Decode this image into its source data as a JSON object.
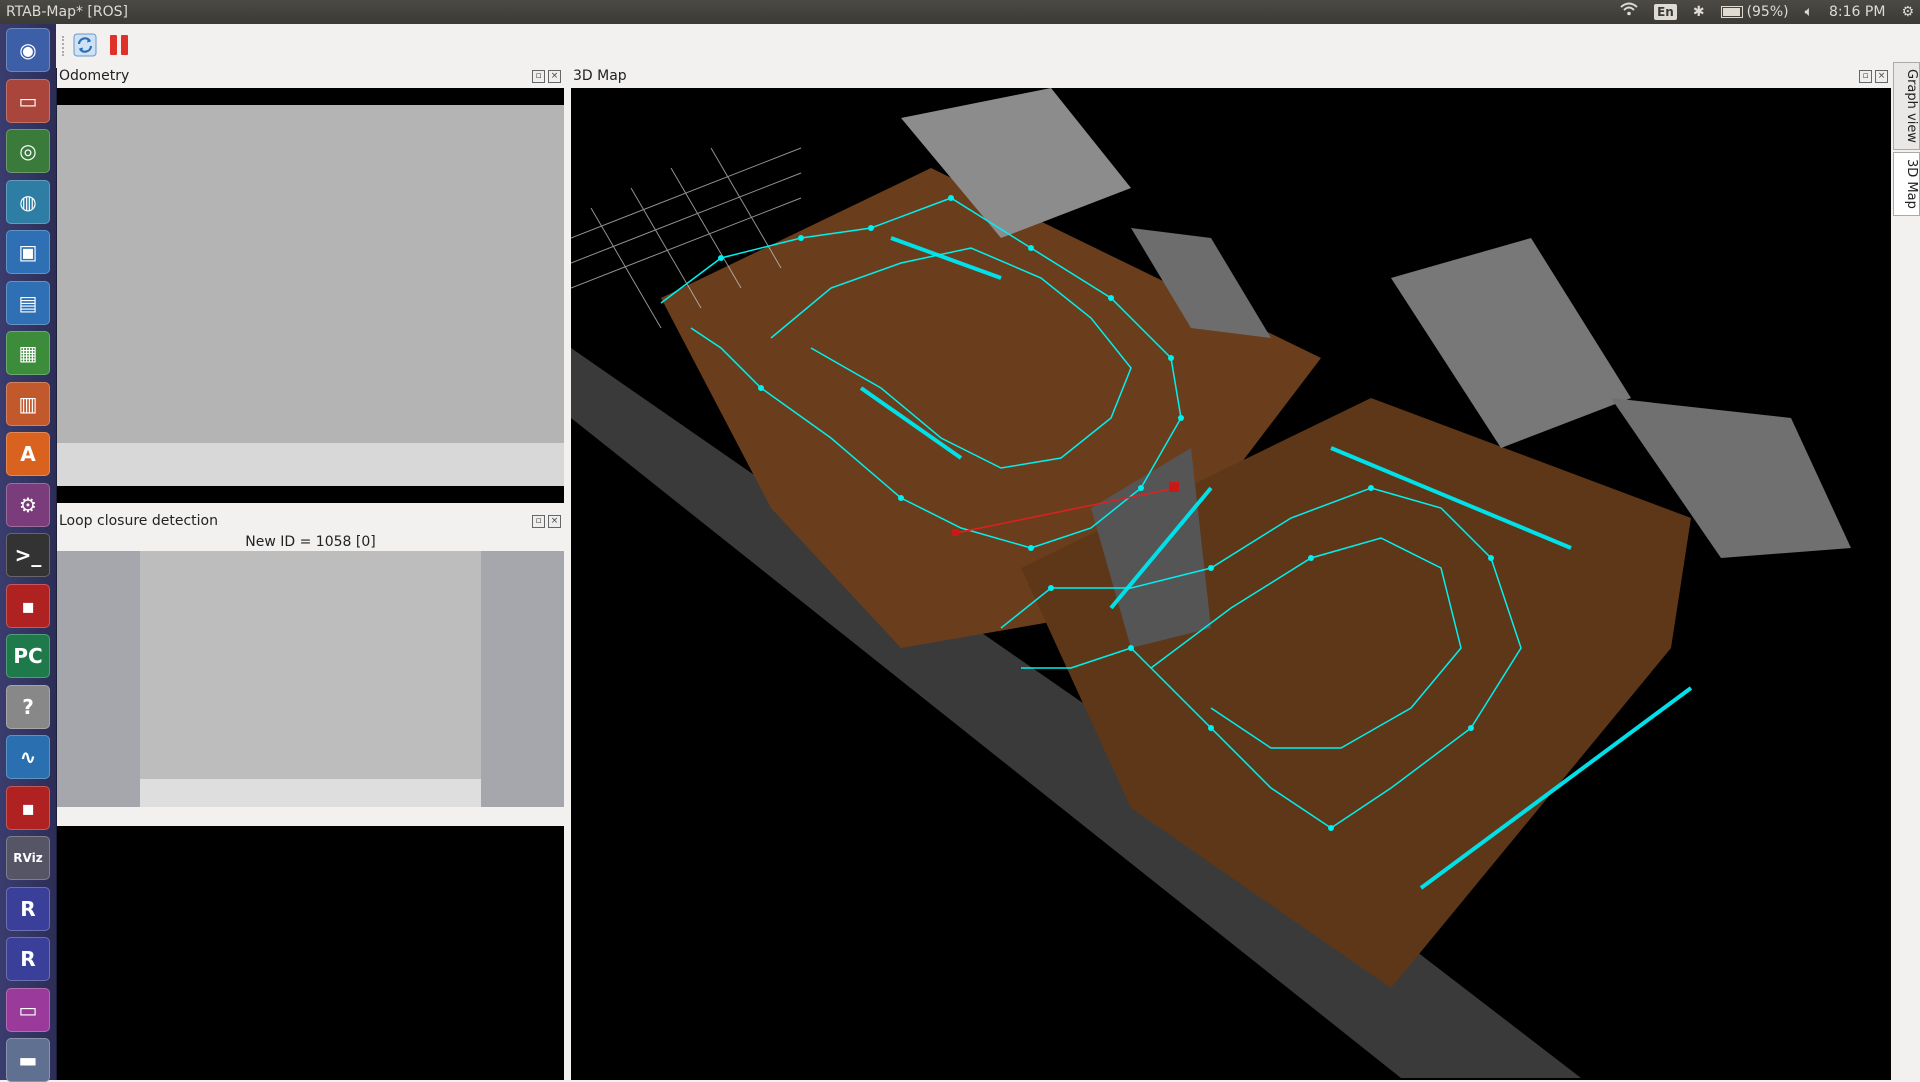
{
  "window": {
    "title": "RTAB-Map* [ROS]"
  },
  "tray": {
    "keyboard": "En",
    "battery": "(95%)",
    "clock": "8:16 PM"
  },
  "launcher": {
    "items": [
      {
        "icon": "ubuntu-dash-icon",
        "glyph": "◉",
        "color": "#3d5fa8"
      },
      {
        "icon": "files-icon",
        "glyph": "▭",
        "color": "#a9453a"
      },
      {
        "icon": "chrome-icon",
        "glyph": "◎",
        "color": "#3a7a3a"
      },
      {
        "icon": "globe-icon",
        "glyph": "◍",
        "color": "#2e7da4"
      },
      {
        "icon": "virtualbox-icon",
        "glyph": "▣",
        "color": "#2f6fb3"
      },
      {
        "icon": "writer-icon",
        "glyph": "▤",
        "color": "#2f6fb3"
      },
      {
        "icon": "calc-icon",
        "glyph": "▦",
        "color": "#3c8c3c"
      },
      {
        "icon": "impress-icon",
        "glyph": "▥",
        "color": "#c2592d"
      },
      {
        "icon": "software-center-icon",
        "glyph": "A",
        "color": "#d9621f"
      },
      {
        "icon": "settings-icon",
        "glyph": "⚙",
        "color": "#7a3c7a"
      },
      {
        "icon": "terminal-icon",
        "glyph": ">_",
        "color": "#333333"
      },
      {
        "icon": "app-red-icon",
        "glyph": "▪",
        "color": "#b02222"
      },
      {
        "icon": "pycharm-icon",
        "glyph": "PC",
        "color": "#1e7a4a"
      },
      {
        "icon": "unknown-app-icon",
        "glyph": "?",
        "color": "#888888"
      },
      {
        "icon": "system-monitor-icon",
        "glyph": "∿",
        "color": "#2a6fb0"
      },
      {
        "icon": "app-red-icon-2",
        "glyph": "▪",
        "color": "#b02222"
      },
      {
        "icon": "rviz-icon",
        "glyph": "RViz",
        "color": "#556"
      },
      {
        "icon": "rtabmap-icon",
        "glyph": "R",
        "color": "#3a3f9a"
      },
      {
        "icon": "rtabmap-icon-2",
        "glyph": "R",
        "color": "#3a3f9a"
      },
      {
        "icon": "workspace-icon",
        "glyph": "▭",
        "color": "#9a3a9a"
      },
      {
        "icon": "trash-icon",
        "glyph": "▬",
        "color": "#607090"
      }
    ]
  },
  "panels": {
    "odometry": {
      "title": "Odometry"
    },
    "loop": {
      "title": "Loop closure detection",
      "caption": "New ID = 1058 [0]"
    },
    "map3d": {
      "title": "3D Map"
    }
  },
  "side_tabs": [
    "Graph view",
    "3D Map"
  ]
}
